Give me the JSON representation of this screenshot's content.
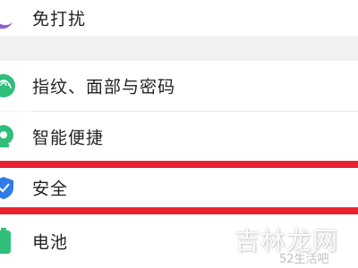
{
  "settings": {
    "items": [
      {
        "label": "免打扰",
        "icon": "moon-icon",
        "color": "#8a63d2"
      },
      {
        "label": "指纹、面部与密码",
        "icon": "fingerprint-icon",
        "color": "#2fbf7a"
      },
      {
        "label": "智能便捷",
        "icon": "smart-assist-icon",
        "color": "#2fbf7a"
      },
      {
        "label": "安全",
        "icon": "shield-icon",
        "color": "#2f7be8"
      },
      {
        "label": "电池",
        "icon": "battery-icon",
        "color": "#2fbf7a"
      }
    ]
  },
  "highlight": {
    "color": "#e8232f"
  },
  "watermark": {
    "main": "吉林龙网",
    "sub": "52生活吧"
  }
}
